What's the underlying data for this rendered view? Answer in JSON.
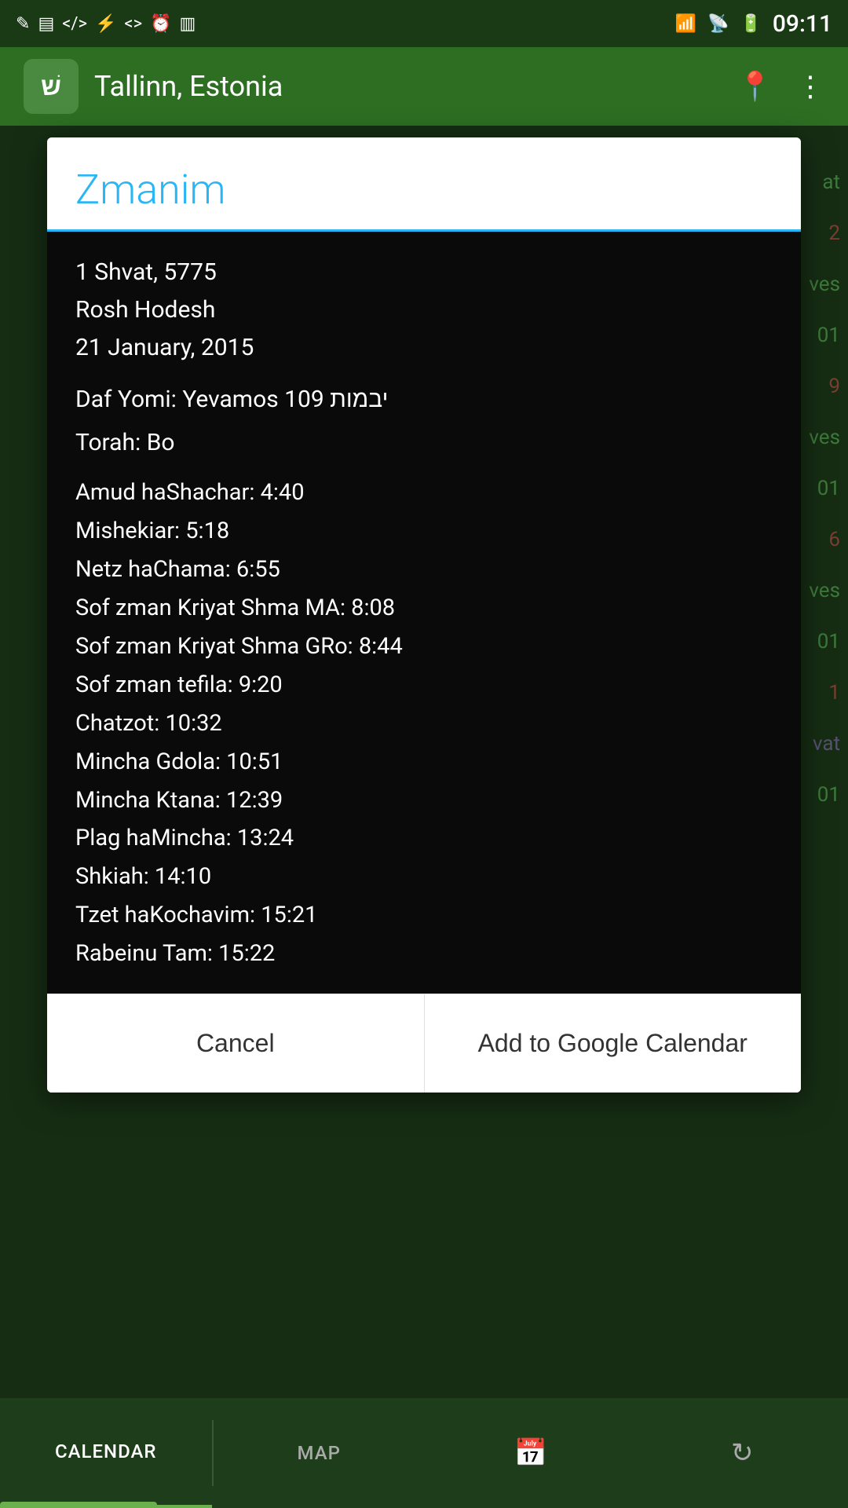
{
  "statusBar": {
    "time": "09:11",
    "icons": [
      "✎",
      "▤",
      "<>",
      "⚡",
      "</>",
      "⏰",
      "▥"
    ]
  },
  "header": {
    "logo": "שׁ",
    "title": "Tallinn, Estonia",
    "locationIcon": "📍",
    "menuIcon": "⋮"
  },
  "dialog": {
    "title": "Zmanim",
    "dateLines": {
      "hebrewDate": "1 Shvat, 5775",
      "specialDay": "Rosh Hodesh",
      "gregorianDate": "21 January, 2015"
    },
    "dafYomi": "Daf Yomi: Yevamos 109 יבמות",
    "torah": "Torah: Bo",
    "zmanim": [
      {
        "label": "Amud haShachar",
        "time": "4:40"
      },
      {
        "label": "Mishekiar",
        "time": "5:18"
      },
      {
        "label": "Netz haChama",
        "time": "6:55"
      },
      {
        "label": "Sof zman Kriyat Shma MA",
        "time": "8:08"
      },
      {
        "label": "Sof zman Kriyat Shma GRo",
        "time": "8:44"
      },
      {
        "label": "Sof zman tefila",
        "time": "9:20"
      },
      {
        "label": "Chatzot",
        "time": "10:32"
      },
      {
        "label": "Mincha Gdola",
        "time": "10:51"
      },
      {
        "label": "Mincha Ktana",
        "time": "12:39"
      },
      {
        "label": "Plag haMincha",
        "time": "13:24"
      },
      {
        "label": "Shkiah",
        "time": "14:10"
      },
      {
        "label": "Tzet haKochavim",
        "time": "15:21"
      },
      {
        "label": "Rabeinu Tam",
        "time": "15:22"
      }
    ],
    "cancelLabel": "Cancel",
    "addCalendarLabel": "Add to Google Calendar"
  },
  "bottomNav": {
    "calendarLabel": "CALENDAR",
    "mapLabel": "MAP",
    "calendarIcon": "📅",
    "refreshIcon": "↻"
  }
}
